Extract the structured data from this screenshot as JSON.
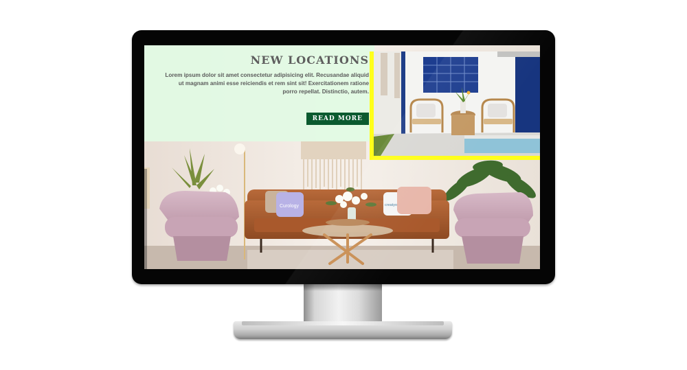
{
  "hero": {
    "heading": "NEW LOCATIONS",
    "body": "Lorem ipsum dolor sit amet consectetur adipisicing elit. Recusandae aliquid ut magnam animi esse reiciendis et rem sint sit! Exercitationem ratione porro repellat. Distinctio, autem.",
    "button_label": "READ MORE"
  },
  "photo": {
    "cushion_left_text": "Curology",
    "cushion_right_text": "creatyourskin"
  },
  "colors": {
    "panel": "#e2fae4",
    "button": "#0b5a2f",
    "accent": "#ffff1a",
    "heading": "#5e5e5e"
  }
}
